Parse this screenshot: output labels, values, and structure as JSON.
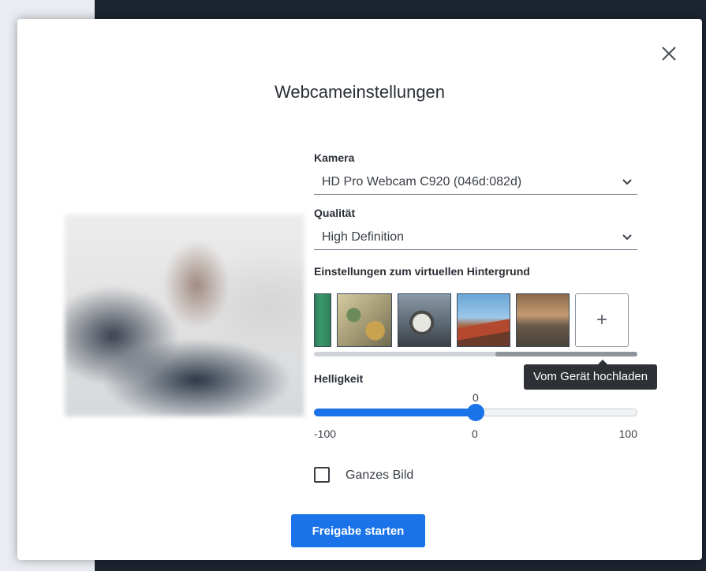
{
  "dialog": {
    "title": "Webcameinstellungen"
  },
  "camera": {
    "label": "Kamera",
    "selected": "HD Pro Webcam C920 (046d:082d)"
  },
  "quality": {
    "label": "Qualität",
    "selected": "High Definition"
  },
  "virtual_background": {
    "label": "Einstellungen zum virtuellen Hintergrund",
    "add_icon": "+",
    "tooltip": "Vom Gerät hochladen"
  },
  "brightness": {
    "label": "Helligkeit",
    "value": 0,
    "value_label": "0",
    "min": -100,
    "max": 100,
    "min_label": "-100",
    "mid_label": "0",
    "max_label": "100"
  },
  "whole_image": {
    "label": "Ganzes Bild",
    "checked": false
  },
  "start_button": {
    "label": "Freigabe starten"
  },
  "colors": {
    "accent": "#1a73e8",
    "backdrop": "#1c2430"
  },
  "icons": {
    "close": "close-icon",
    "chevron": "chevron-down-icon",
    "add": "plus-icon"
  }
}
